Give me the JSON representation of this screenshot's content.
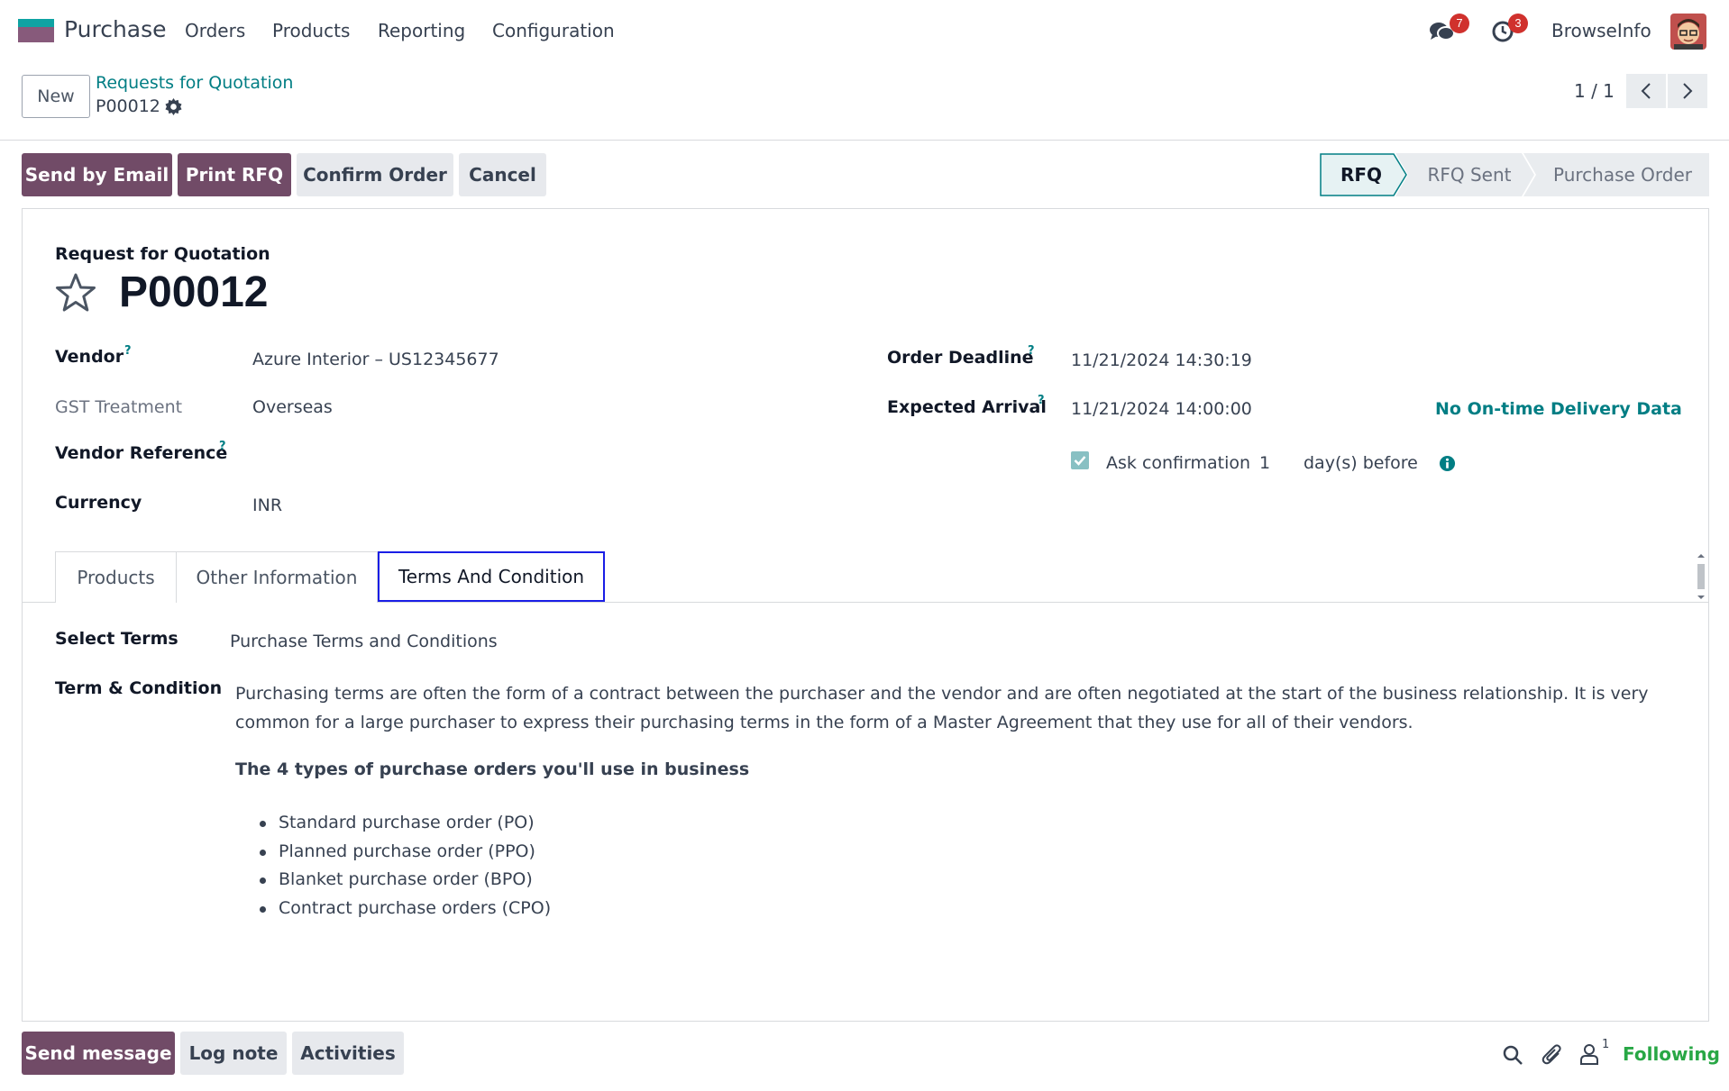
{
  "navbar": {
    "app_name": "Purchase",
    "menu": [
      "Orders",
      "Products",
      "Reporting",
      "Configuration"
    ],
    "messages_badge": "7",
    "activities_badge": "3",
    "user_name": "BrowseInfo"
  },
  "control_panel": {
    "new_label": "New",
    "breadcrumb": "Requests for Quotation",
    "record_name": "P00012",
    "pager": "1 / 1"
  },
  "actions": {
    "send_email": "Send by Email",
    "print_rfq": "Print RFQ",
    "confirm_order": "Confirm Order",
    "cancel": "Cancel"
  },
  "statusbar": {
    "stages": [
      "RFQ",
      "RFQ Sent",
      "Purchase Order"
    ],
    "active": "RFQ"
  },
  "form": {
    "subtitle": "Request for Quotation",
    "title": "P00012",
    "vendor_label": "Vendor",
    "vendor_value": "Azure Interior – US12345677",
    "gst_label": "GST Treatment",
    "gst_value": "Overseas",
    "vendor_ref_label": "Vendor Reference",
    "currency_label": "Currency",
    "currency_value": "INR",
    "order_deadline_label": "Order Deadline",
    "order_deadline_value": "11/21/2024 14:30:19",
    "expected_arrival_label": "Expected Arrival",
    "expected_arrival_value": "11/21/2024 14:00:00",
    "on_time_link": "No On-time Delivery Data",
    "ask_confirmation_label": "Ask confirmation",
    "ask_confirmation_days": "1",
    "days_before": "day(s) before",
    "help_mark": "?"
  },
  "tabs": [
    "Products",
    "Other Information",
    "Terms And Condition"
  ],
  "active_tab": "Terms And Condition",
  "terms": {
    "select_terms_label": "Select Terms",
    "select_terms_value": "Purchase Terms and Conditions",
    "term_condition_label": "Term & Condition",
    "paragraph": "Purchasing terms are often the form of a contract between the purchaser and the vendor and are often negotiated at the start of the business relationship. It is very common for a large purchaser to express their purchasing terms in the form of a Master Agreement that they use for all of their vendors.",
    "heading": "The 4 types of purchase orders you'll use in business",
    "list": [
      "Standard purchase order (PO)",
      "Planned purchase order (PPO)",
      "Blanket purchase order (BPO)",
      "Contract purchase orders (CPO)"
    ]
  },
  "chatter": {
    "send_message": "Send message",
    "log_note": "Log note",
    "activities": "Activities",
    "followers_count": "1",
    "following": "Following"
  },
  "colors": {
    "primary": "#714b67",
    "teal": "#017e84",
    "following": "#28a745",
    "badge": "#d0312d",
    "tab_focus": "#1a1ee6"
  }
}
